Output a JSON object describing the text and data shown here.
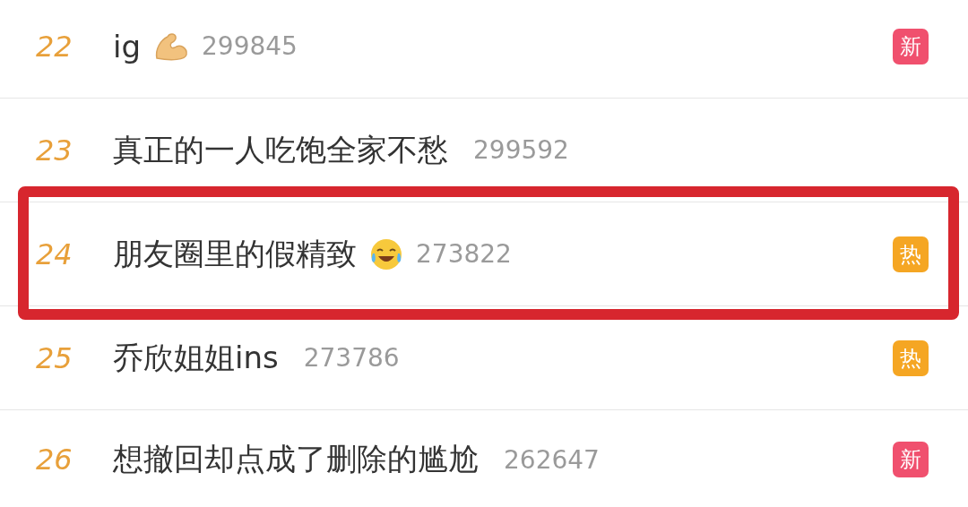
{
  "rows": [
    {
      "rank": "22",
      "title": "ig",
      "kind": "arm",
      "count": "299845",
      "badge": {
        "label": "新",
        "color": "#f0506e"
      },
      "highlighted": false
    },
    {
      "rank": "23",
      "title": "真正的一人吃饱全家不愁",
      "kind": "plain",
      "count": "299592",
      "highlighted": false
    },
    {
      "rank": "24",
      "title": "朋友圈里的假精致",
      "kind": "face",
      "count": "273822",
      "badge": {
        "label": "热",
        "color": "#f5a623"
      },
      "highlighted": true
    },
    {
      "rank": "25",
      "title": "乔欣姐姐ins",
      "kind": "plain",
      "count": "273786",
      "badge": {
        "label": "热",
        "color": "#f5a623"
      },
      "highlighted": false
    },
    {
      "rank": "26",
      "title": "想撤回却点成了删除的尴尬",
      "kind": "plain",
      "count": "262647",
      "badge": {
        "label": "新",
        "color": "#f0506e"
      },
      "highlighted": false
    }
  ]
}
